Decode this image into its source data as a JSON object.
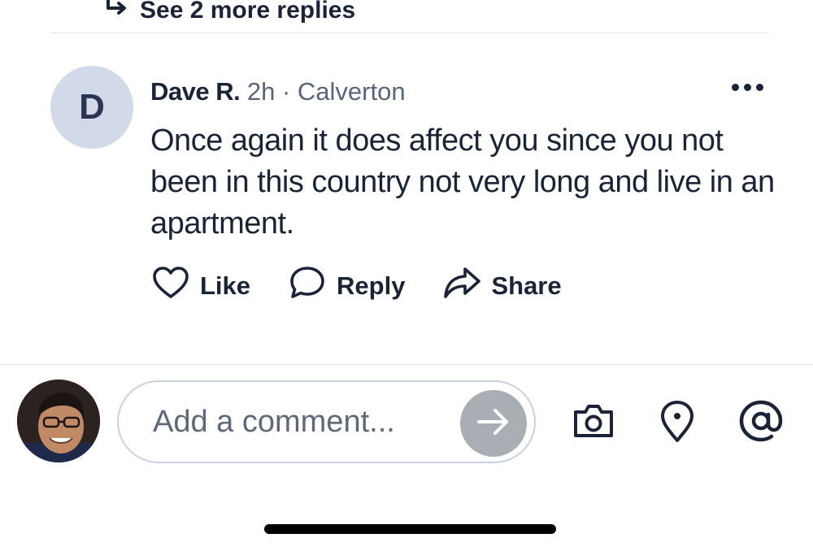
{
  "thread": {
    "more_replies_label": "See 2 more replies"
  },
  "comment": {
    "avatar_initial": "D",
    "author": "Dave R.",
    "time": "2h",
    "separator": "·",
    "location": "Calverton",
    "body": "Once again it does affect you since you not been in this country not very long and live in an apartment.",
    "actions": {
      "like": "Like",
      "reply": "Reply",
      "share": "Share"
    }
  },
  "composer": {
    "placeholder": "Add a comment..."
  },
  "icons": {
    "more_replies": "reply-arrow-icon",
    "menu": "more-dots-icon",
    "like": "heart-icon",
    "reply": "speech-bubble-icon",
    "share": "share-arrow-icon",
    "send": "arrow-right-icon",
    "camera": "camera-icon",
    "location": "map-pin-icon",
    "mention": "at-sign-icon"
  },
  "colors": {
    "text": "#1b2437",
    "meta": "#5a6478",
    "avatar_bg": "#d2dae9",
    "send_bg": "#a9aeb5",
    "field_border": "#c9d1e0"
  }
}
